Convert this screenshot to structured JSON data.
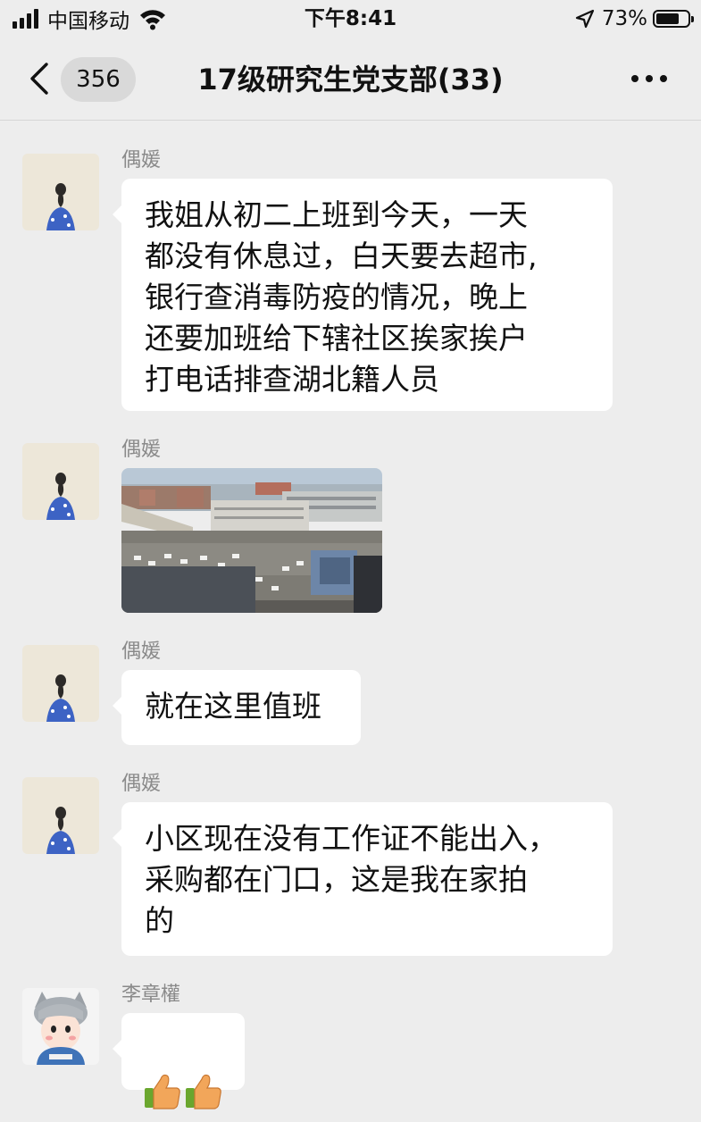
{
  "status_bar": {
    "carrier": "中国移动",
    "time": "下午8:41",
    "battery_percent": "73%",
    "battery_level": 0.73
  },
  "nav": {
    "back_count": "356",
    "title": "17级研究生党支部(33)"
  },
  "messages": [
    {
      "sender": "偶媛",
      "type": "text",
      "text": "我姐从初二上班到今天，一天\n都没有休息过，白天要去超市,\n银行查消毒防疫的情况，晚上\n还要加班给下辖社区挨家挨户\n打电话排查湖北籍人员"
    },
    {
      "sender": "偶媛",
      "type": "image"
    },
    {
      "sender": "偶媛",
      "type": "text",
      "text": "就在这里值班"
    },
    {
      "sender": "偶媛",
      "type": "text",
      "text": "小区现在没有工作证不能出入，\n采购都在门口，这是我在家拍\n的"
    },
    {
      "sender": "李章權",
      "type": "emoji",
      "emoji": "thumbs-up-thumbs-up"
    }
  ],
  "icons": {
    "back": "chevron-left-icon",
    "more": "more-dots-icon",
    "wifi": "wifi-icon",
    "location": "location-arrow-icon"
  }
}
